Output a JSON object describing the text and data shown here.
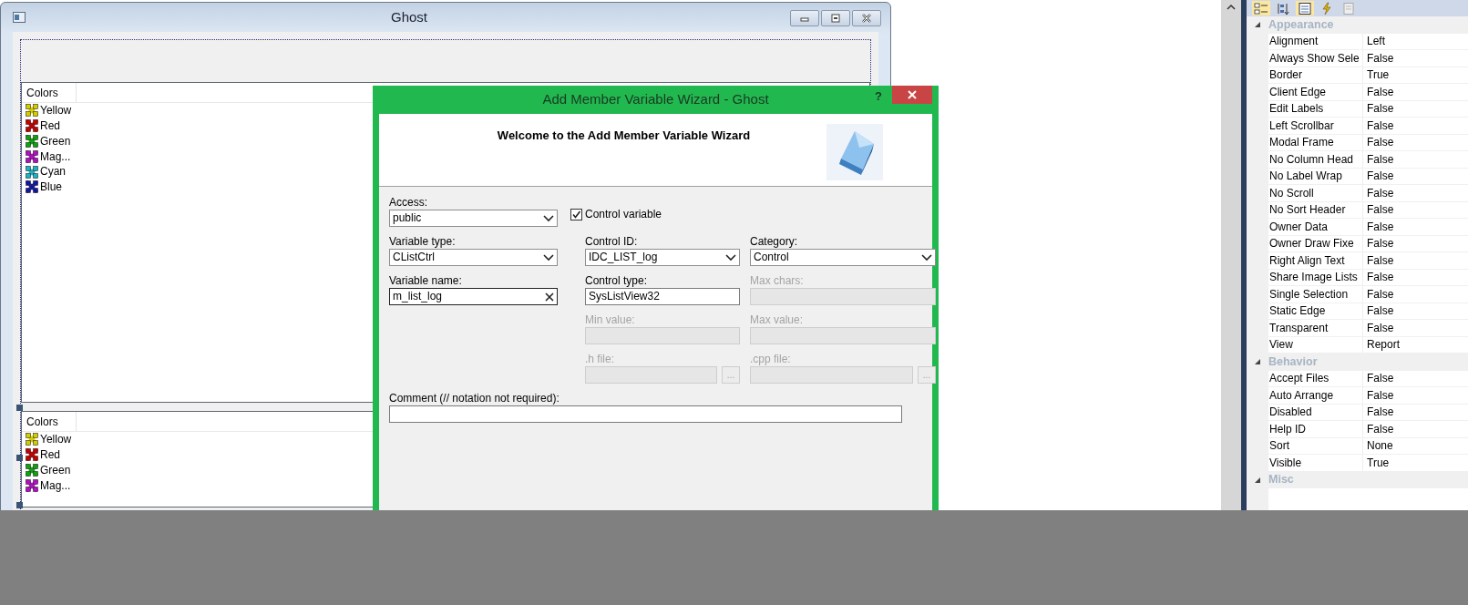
{
  "ghost_window": {
    "title": "Ghost",
    "lists": [
      {
        "column": "Colors",
        "items": [
          {
            "label": "Yellow",
            "color": "#d4cc00"
          },
          {
            "label": "Red",
            "color": "#c40000"
          },
          {
            "label": "Green",
            "color": "#12a012"
          },
          {
            "label": "Mag...",
            "color": "#b010c0"
          },
          {
            "label": "Cyan",
            "color": "#20b0c0"
          },
          {
            "label": "Blue",
            "color": "#1414a0"
          }
        ]
      },
      {
        "column": "Colors",
        "items": [
          {
            "label": "Yellow",
            "color": "#d4cc00"
          },
          {
            "label": "Red",
            "color": "#c40000"
          },
          {
            "label": "Green",
            "color": "#12a012"
          },
          {
            "label": "Mag...",
            "color": "#b010c0"
          }
        ]
      }
    ]
  },
  "wizard": {
    "title": "Add Member Variable Wizard - Ghost",
    "help": "?",
    "heading": "Welcome to the Add Member Variable Wizard",
    "columns": [
      [
        {
          "kind": "dropdown",
          "label": "Access:",
          "value": "public",
          "disabled": false
        },
        {
          "kind": "dropdown",
          "label": "Variable type:",
          "value": "CListCtrl",
          "disabled": false
        },
        {
          "kind": "clearable",
          "label": "Variable name:",
          "value": "m_list_log",
          "disabled": false
        }
      ],
      [
        {
          "kind": "checkbox",
          "label": "Control variable",
          "checked": true
        },
        {
          "kind": "dropdown",
          "label": "Control ID:",
          "value": "IDC_LIST_log",
          "disabled": false
        },
        {
          "kind": "textbox",
          "label": "Control type:",
          "value": "SysListView32",
          "disabled": false
        },
        {
          "kind": "textbox",
          "label": "Min value:",
          "disabled": true
        },
        {
          "kind": "browse",
          "label": ".h file:",
          "button": "...",
          "disabled": true
        }
      ],
      [
        {
          "kind": "dropdown",
          "label": "Category:",
          "value": "Control",
          "disabled": false
        },
        {
          "kind": "textbox",
          "label": "Max chars:",
          "disabled": true
        },
        {
          "kind": "textbox",
          "label": "Max value:",
          "disabled": true
        },
        {
          "kind": "browse",
          "label": ".cpp file:",
          "button": "...",
          "disabled": true
        }
      ]
    ],
    "comment": {
      "label": "Comment (// notation not required):"
    }
  },
  "property_grid": {
    "toolbar": [
      {
        "kind": "categorized",
        "selected": true
      },
      {
        "kind": "alphabetical",
        "selected": false
      },
      {
        "kind": "properties",
        "selected": true
      },
      {
        "kind": "events",
        "selected": false
      },
      {
        "kind": "pages",
        "selected": false
      }
    ],
    "categories": [
      {
        "name": "Appearance",
        "expanded": true,
        "properties": [
          {
            "name": "Alignment",
            "value": "Left"
          },
          {
            "name": "Always Show Sele",
            "value": "False"
          },
          {
            "name": "Border",
            "value": "True"
          },
          {
            "name": "Client Edge",
            "value": "False"
          },
          {
            "name": "Edit Labels",
            "value": "False"
          },
          {
            "name": "Left Scrollbar",
            "value": "False"
          },
          {
            "name": "Modal Frame",
            "value": "False"
          },
          {
            "name": "No Column Head",
            "value": "False"
          },
          {
            "name": "No Label Wrap",
            "value": "False"
          },
          {
            "name": "No Scroll",
            "value": "False"
          },
          {
            "name": "No Sort Header",
            "value": "False"
          },
          {
            "name": "Owner Data",
            "value": "False"
          },
          {
            "name": "Owner Draw Fixe",
            "value": "False"
          },
          {
            "name": "Right Align Text",
            "value": "False"
          },
          {
            "name": "Share Image Lists",
            "value": "False"
          },
          {
            "name": "Single Selection",
            "value": "False"
          },
          {
            "name": "Static Edge",
            "value": "False"
          },
          {
            "name": "Transparent",
            "value": "False"
          },
          {
            "name": "View",
            "value": "Report"
          }
        ]
      },
      {
        "name": "Behavior",
        "expanded": true,
        "properties": [
          {
            "name": "Accept Files",
            "value": "False"
          },
          {
            "name": "Auto Arrange",
            "value": "False"
          },
          {
            "name": "Disabled",
            "value": "False"
          },
          {
            "name": "Help ID",
            "value": "False"
          },
          {
            "name": "Sort",
            "value": "None"
          },
          {
            "name": "Visible",
            "value": "True"
          }
        ]
      },
      {
        "name": "Misc",
        "expanded": true
      }
    ]
  }
}
